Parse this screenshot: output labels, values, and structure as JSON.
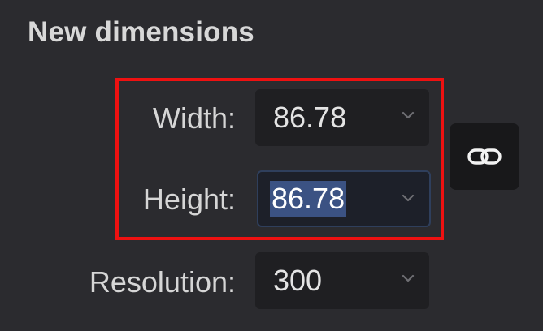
{
  "section": {
    "title": "New dimensions"
  },
  "width": {
    "label": "Width:",
    "value": "86.78",
    "icon": "chevron-down-icon"
  },
  "height": {
    "label": "Height:",
    "value": "86.78",
    "icon": "chevron-down-icon"
  },
  "resolution": {
    "label": "Resolution:",
    "value": "300",
    "icon": "chevron-down-icon"
  },
  "constrain": {
    "icon": "link-icon"
  },
  "colors": {
    "background": "#2b2b2f",
    "field": "#1f1f22",
    "selection": "#3b5283",
    "highlight": "#ee1111"
  }
}
